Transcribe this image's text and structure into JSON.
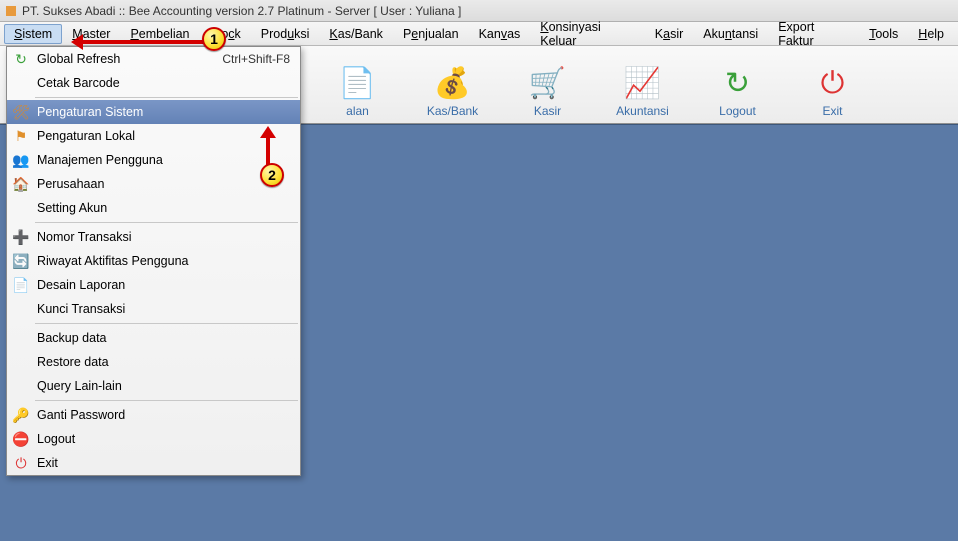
{
  "title": "PT. Sukses Abadi :: Bee Accounting version 2.7 Platinum - Server  [ User : Yuliana ]",
  "menubar": [
    {
      "label": "Sistem",
      "ul": "S",
      "active": true
    },
    {
      "label": "Master",
      "ul": "M"
    },
    {
      "label": "Pembelian",
      "ul": "P"
    },
    {
      "label": "Stock",
      "ul": "c"
    },
    {
      "label": "Produksi",
      "ul": "u"
    },
    {
      "label": "Kas/Bank",
      "ul": "K"
    },
    {
      "label": "Penjualan",
      "ul": "e"
    },
    {
      "label": "Kanvas",
      "ul": "v"
    },
    {
      "label": "Konsinyasi Keluar",
      "ul": "K"
    },
    {
      "label": "Kasir",
      "ul": "a"
    },
    {
      "label": "Akuntansi",
      "ul": "n"
    },
    {
      "label": "Export Faktur",
      "ul": ""
    },
    {
      "label": "Tools",
      "ul": "T"
    },
    {
      "label": "Help",
      "ul": "H"
    }
  ],
  "toolbar": [
    {
      "name": "penjualan",
      "label": "alan",
      "icon": "📄",
      "color": "#e37b2d"
    },
    {
      "name": "kasbank",
      "label": "Kas/Bank",
      "icon": "💰",
      "color": "#d9a43b"
    },
    {
      "name": "kasir",
      "label": "Kasir",
      "icon": "🛒",
      "color": "#3a6da8"
    },
    {
      "name": "akuntansi",
      "label": "Akuntansi",
      "icon": "📈",
      "color": "#3a9a3a"
    },
    {
      "name": "logout",
      "label": "Logout",
      "icon": "↻",
      "color": "#3aa03a"
    },
    {
      "name": "exit",
      "label": "Exit",
      "icon": "⏻",
      "color": "#d33"
    }
  ],
  "dropdown": [
    {
      "type": "item",
      "icon": "↻",
      "iconColor": "#3aa03a",
      "label": "Global Refresh",
      "accel": "Ctrl+Shift-F8"
    },
    {
      "type": "item",
      "icon": "",
      "label": "Cetak Barcode"
    },
    {
      "type": "sep"
    },
    {
      "type": "item",
      "icon": "🛠",
      "iconColor": "#d98a2b",
      "label": "Pengaturan Sistem",
      "highlight": true
    },
    {
      "type": "item",
      "icon": "⚑",
      "iconColor": "#e0902c",
      "label": "Pengaturan Lokal"
    },
    {
      "type": "item",
      "icon": "👥",
      "iconColor": "#d98a2b",
      "label": "Manajemen Pengguna"
    },
    {
      "type": "item",
      "icon": "🏠",
      "iconColor": "#d98a2b",
      "label": "Perusahaan"
    },
    {
      "type": "item",
      "icon": "",
      "label": "Setting Akun"
    },
    {
      "type": "sep"
    },
    {
      "type": "item",
      "icon": "➕",
      "iconColor": "#3aa03a",
      "label": "Nomor Transaksi"
    },
    {
      "type": "item",
      "icon": "🔄",
      "iconColor": "#3a7ad9",
      "label": "Riwayat Aktifitas Pengguna"
    },
    {
      "type": "item",
      "icon": "📄",
      "iconColor": "#e0c23a",
      "label": "Desain Laporan"
    },
    {
      "type": "item",
      "icon": "",
      "label": "Kunci Transaksi"
    },
    {
      "type": "sep"
    },
    {
      "type": "item",
      "icon": "",
      "label": "Backup data"
    },
    {
      "type": "item",
      "icon": "",
      "label": "Restore data"
    },
    {
      "type": "item",
      "icon": "",
      "label": "Query Lain-lain"
    },
    {
      "type": "sep"
    },
    {
      "type": "item",
      "icon": "🔑",
      "iconColor": "#d9b33a",
      "label": "Ganti Password"
    },
    {
      "type": "item",
      "icon": "⛔",
      "iconColor": "#d33",
      "label": "Logout"
    },
    {
      "type": "item",
      "icon": "⏻",
      "iconColor": "#d33",
      "label": "Exit"
    }
  ],
  "markers": {
    "m1": "1",
    "m2": "2"
  }
}
